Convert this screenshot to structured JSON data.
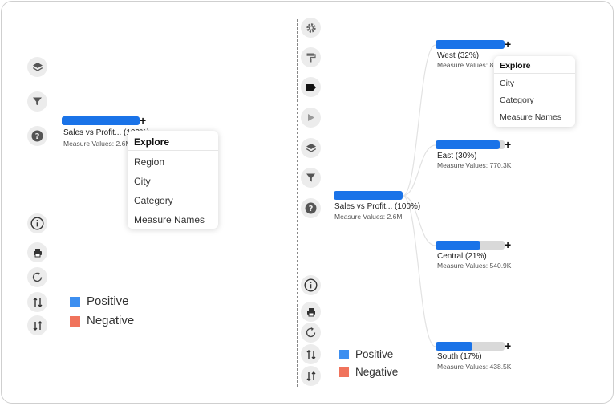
{
  "left": {
    "root": {
      "label": "Sales vs Profit... (100%)",
      "sub": "Measure Values: 2.6M",
      "fill": 1.0
    },
    "menu": {
      "title": "Explore",
      "items": [
        "Region",
        "City",
        "Category",
        "Measure Names"
      ]
    },
    "legend": [
      {
        "label": "Positive",
        "color": "#3d8ff0"
      },
      {
        "label": "Negative",
        "color": "#f0735c"
      }
    ]
  },
  "right": {
    "root": {
      "label": "Sales vs Profit... (100%)",
      "sub": "Measure Values: 2.6M",
      "fill": 1.0
    },
    "children": [
      {
        "label": "West (32%)",
        "sub": "Measure Values: 8",
        "fill": 1.0
      },
      {
        "label": "East (30%)",
        "sub": "Measure Values: 770.3K",
        "fill": 0.93
      },
      {
        "label": "Central (21%)",
        "sub": "Measure Values: 540.9K",
        "fill": 0.65
      },
      {
        "label": "South (17%)",
        "sub": "Measure Values: 438.5K",
        "fill": 0.53
      }
    ],
    "menu": {
      "title": "Explore",
      "items": [
        "City",
        "Category",
        "Measure Names"
      ]
    },
    "legend": [
      {
        "label": "Positive",
        "color": "#3d8ff0"
      },
      {
        "label": "Negative",
        "color": "#f0735c"
      }
    ]
  },
  "plus_symbol": "+",
  "colors": {
    "bar": "#1a73e8",
    "track": "#d9d9d9",
    "icon_bg": "#ececec"
  },
  "icons": {
    "left_toolbar_top": [
      "layers-icon",
      "filter-icon",
      "help-icon"
    ],
    "left_toolbar_bottom": [
      "info-icon",
      "print-icon",
      "refresh-icon",
      "sort-ascending-icon",
      "sort-descending-icon"
    ],
    "right_toolbar_top": [
      "gear-icon",
      "paint-roller-icon",
      "tag-icon",
      "play-icon",
      "layers-icon",
      "filter-icon",
      "help-icon"
    ],
    "right_toolbar_bottom": [
      "info-icon",
      "print-icon",
      "refresh-icon",
      "sort-ascending-icon",
      "sort-descending-icon"
    ]
  }
}
